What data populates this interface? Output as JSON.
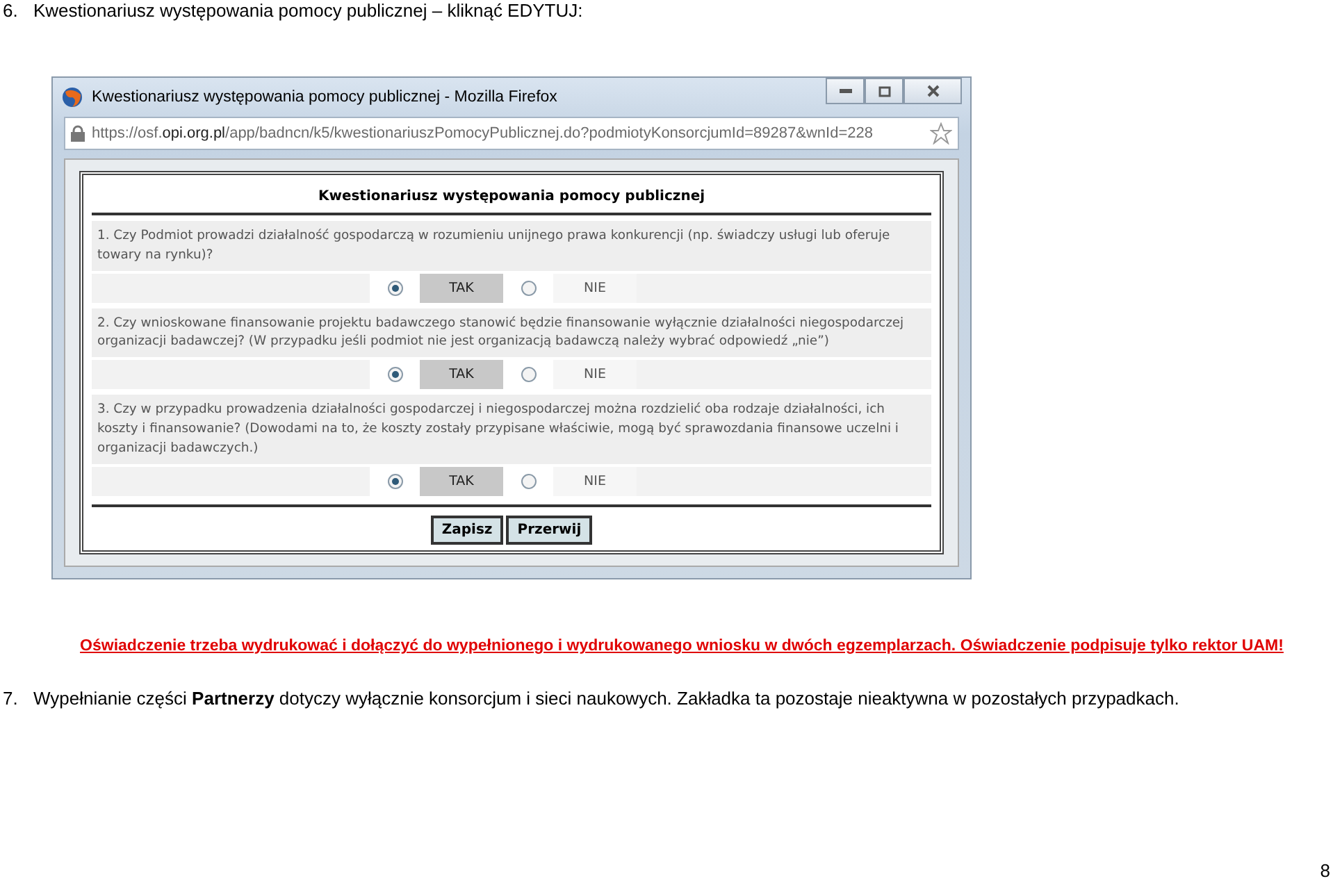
{
  "step6": {
    "number": "6.",
    "text": "Kwestionariusz występowania pomocy publicznej – kliknąć EDYTUJ:"
  },
  "window": {
    "title": "Kwestionariusz występowania pomocy publicznej - Mozilla Firefox",
    "url_prefix": "https://osf.",
    "url_domain": "opi.org.pl",
    "url_rest": "/app/badncn/k5/kwestionariuszPomocyPublicznej.do?podmiotyKonsorcjumId=89287&wnId=228"
  },
  "form": {
    "title": "Kwestionariusz występowania pomocy publicznej",
    "questions": [
      {
        "text": "1. Czy Podmiot prowadzi działalność gospodarczą w rozumieniu unijnego prawa konkurencji (np. świadczy usługi lub oferuje towary na rynku)?",
        "options": [
          {
            "label": "TAK",
            "selected": true
          },
          {
            "label": "NIE",
            "selected": false
          }
        ]
      },
      {
        "text": "2. Czy wnioskowane finansowanie projektu badawczego stanowić będzie finansowanie wyłącznie działalności niegospodarczej organizacji badawczej? (W przypadku jeśli podmiot nie jest organizacją badawczą należy wybrać odpowiedź „nie”)",
        "options": [
          {
            "label": "TAK",
            "selected": true
          },
          {
            "label": "NIE",
            "selected": false
          }
        ]
      },
      {
        "text": "3. Czy w przypadku prowadzenia działalności gospodarczej i niegospodarczej można rozdzielić oba rodzaje działalności, ich koszty i finansowanie? (Dowodami na to, że koszty zostały przypisane właściwie, mogą być sprawozdania finansowe uczelni i organizacji badawczych.)",
        "options": [
          {
            "label": "TAK",
            "selected": true
          },
          {
            "label": "NIE",
            "selected": false
          }
        ]
      }
    ],
    "buttons": [
      "Zapisz",
      "Przerwij"
    ]
  },
  "notice": "Oświadczenie trzeba wydrukować i dołączyć do wypełnionego i wydrukowanego wniosku w dwóch egzemplarzach. Oświadczenie podpisuje tylko rektor UAM!",
  "step7": {
    "number": "7.",
    "text": "Wypełnianie części **Partnerzy** dotyczy wyłącznie konsorcjum i sieci naukowych. Zakładka ta pozostaje nieaktywna w pozostałych przypadkach."
  },
  "page_number": "8"
}
